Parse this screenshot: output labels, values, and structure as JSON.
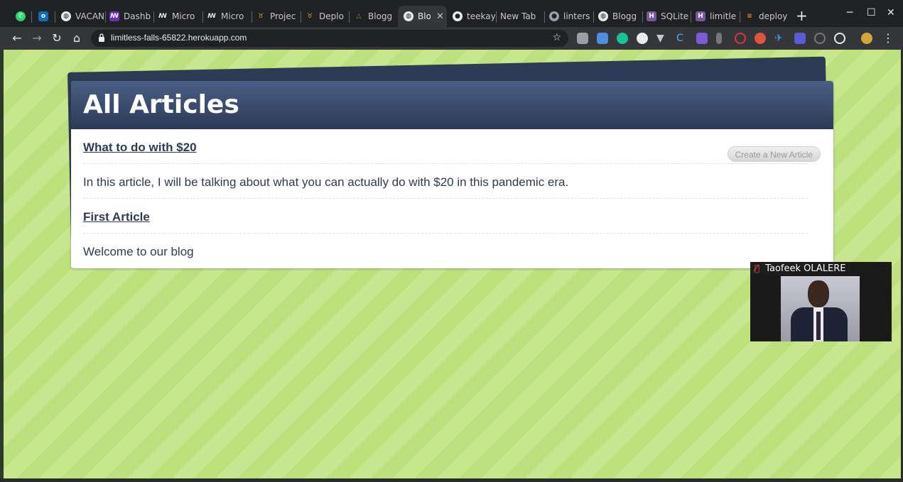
{
  "browser": {
    "tabs": [
      {
        "label": "",
        "icon": "whatsapp-icon",
        "color": "#25d366"
      },
      {
        "label": "",
        "icon": "outlook-icon",
        "color": "#0f6cbd"
      },
      {
        "label": "VACAN",
        "icon": "globe-icon",
        "color": "#9aa0a6"
      },
      {
        "label": "Dashb",
        "icon": "microverse-icon",
        "color": "#6f2dbd"
      },
      {
        "label": "Micro",
        "icon": "microverse-icon",
        "color": "#9aa0a6"
      },
      {
        "label": "Micro",
        "icon": "microverse-icon",
        "color": "#9aa0a6"
      },
      {
        "label": "Projec",
        "icon": "project-icon",
        "color": "#e8a030"
      },
      {
        "label": "Deplo",
        "icon": "project-icon",
        "color": "#e8a030"
      },
      {
        "label": "Blogg",
        "icon": "blogger-icon",
        "color": "#4caf50"
      },
      {
        "label": "Blo",
        "icon": "globe-icon",
        "color": "#9aa0a6",
        "active": true
      },
      {
        "label": "teekay",
        "icon": "github-icon",
        "color": "#9aa0a6"
      },
      {
        "label": "New Tab",
        "icon": "",
        "color": ""
      },
      {
        "label": "linters",
        "icon": "github-icon",
        "color": "#9aa0a6"
      },
      {
        "label": "Blogg",
        "icon": "globe-icon",
        "color": "#9aa0a6"
      },
      {
        "label": "SQLite",
        "icon": "heroku-icon",
        "color": "#79589f"
      },
      {
        "label": "limitle",
        "icon": "heroku-icon",
        "color": "#79589f"
      },
      {
        "label": "deploy",
        "icon": "stackoverflow-icon",
        "color": "#f48024"
      }
    ],
    "address": "limitless-falls-65822.herokuapp.com"
  },
  "page": {
    "title": "All Articles",
    "create_button": "Create a New Article",
    "articles": [
      {
        "title": "What to do with $20",
        "body": "In this article, I will be talking about what you can actually do with $20 in this pandemic era."
      },
      {
        "title": "First Article",
        "body": "Welcome to our blog"
      }
    ]
  },
  "video_call": {
    "participant_name": "Taofeek OLALERE"
  }
}
